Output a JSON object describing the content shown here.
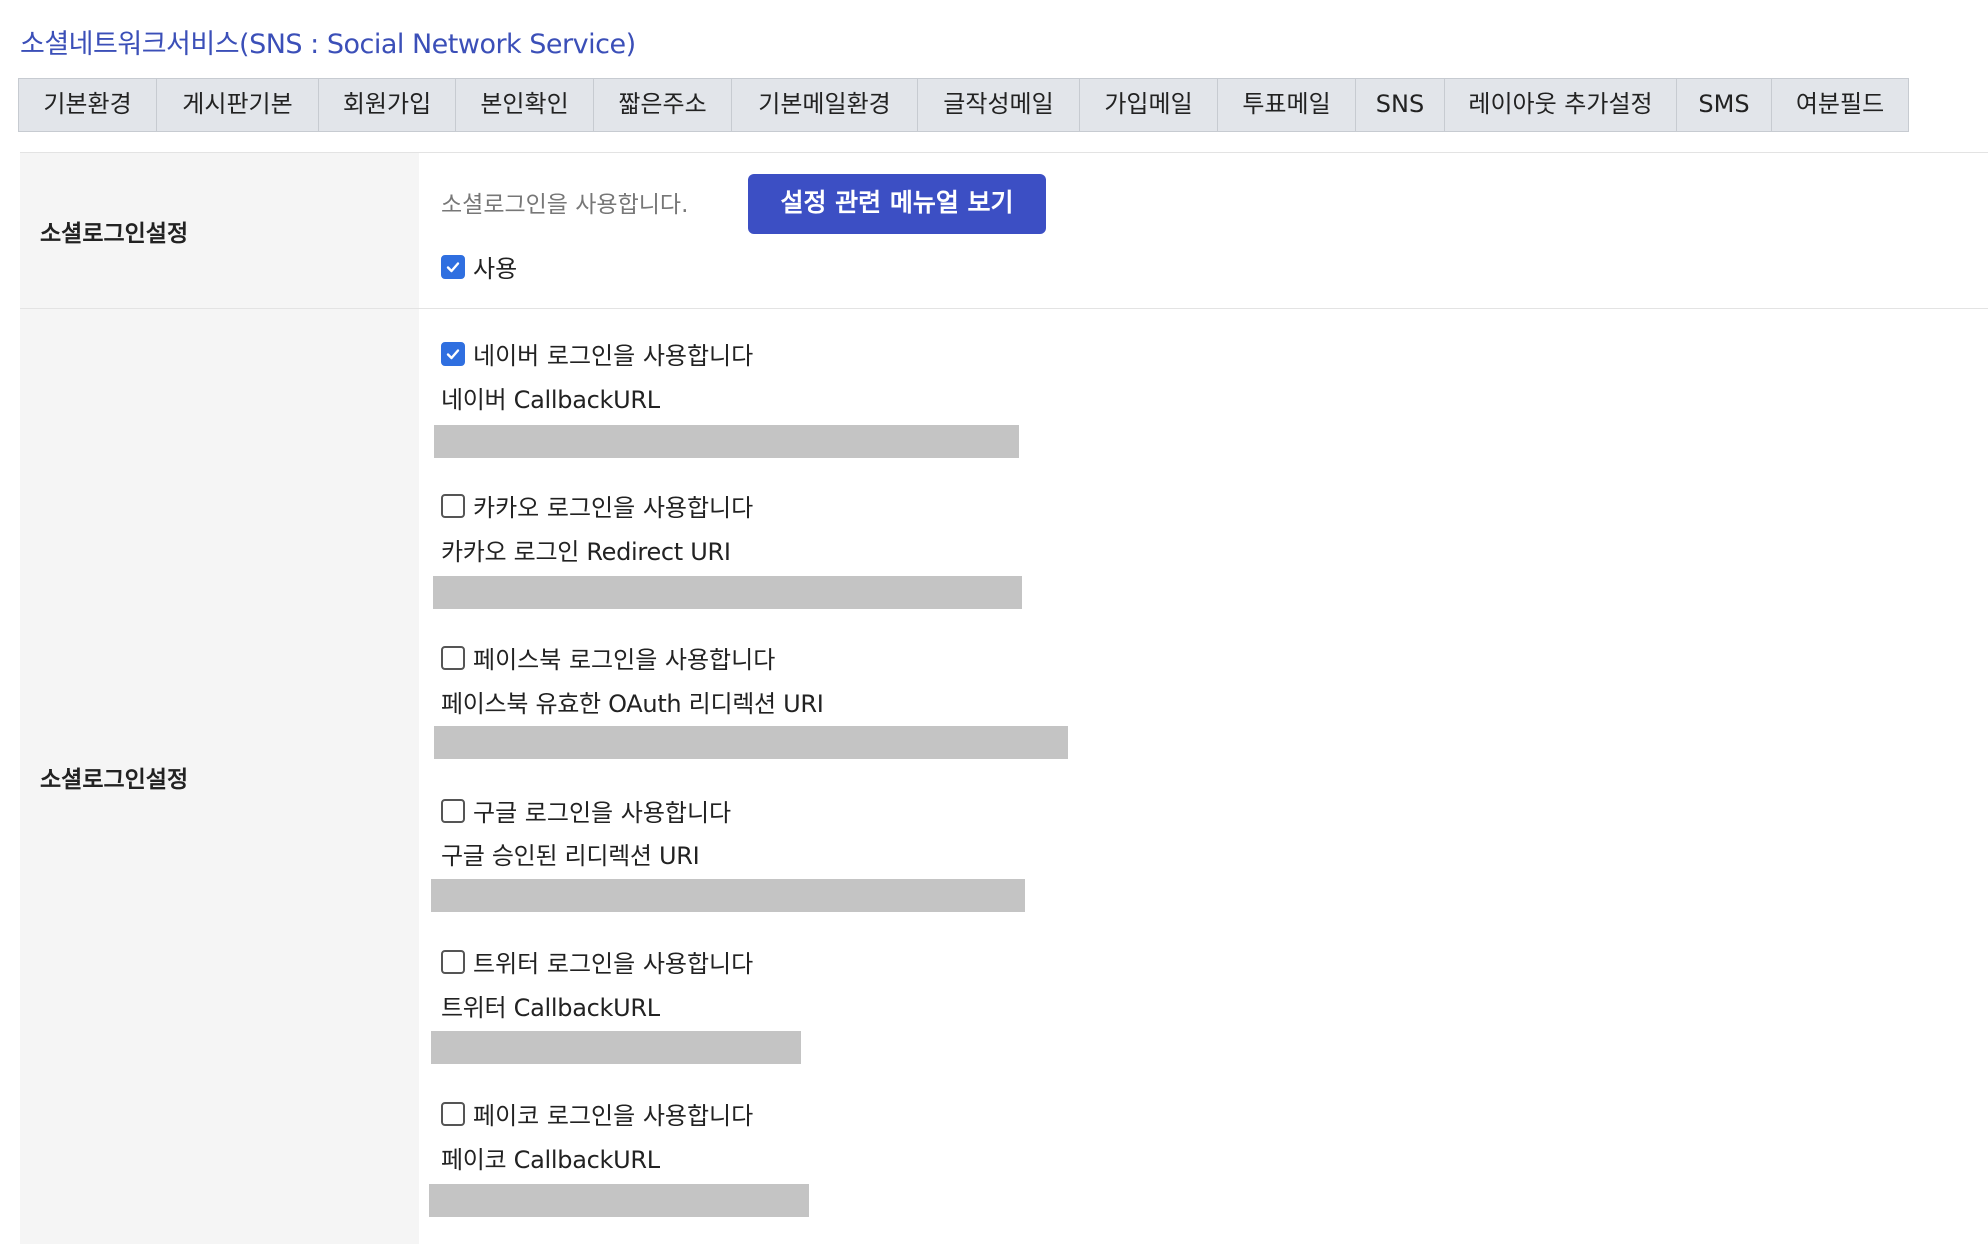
{
  "page": {
    "title": "소셜네트워크서비스(SNS : Social Network Service)"
  },
  "tabs": [
    {
      "label": "기본환경"
    },
    {
      "label": "게시판기본"
    },
    {
      "label": "회원가입"
    },
    {
      "label": "본인확인"
    },
    {
      "label": "짧은주소"
    },
    {
      "label": "기본메일환경"
    },
    {
      "label": "글작성메일"
    },
    {
      "label": "가입메일"
    },
    {
      "label": "투표메일"
    },
    {
      "label": "SNS"
    },
    {
      "label": "레이아웃 추가설정"
    },
    {
      "label": "SMS"
    },
    {
      "label": "여분필드"
    }
  ],
  "social_login_enable": {
    "label": "소셜로그인설정",
    "help_text": "소셜로그인을 사용합니다.",
    "manual_button_label": "설정 관련 메뉴얼 보기",
    "use_checkbox_label": "사용",
    "use_checked": true
  },
  "providers_section": {
    "label": "소셜로그인설정",
    "providers": [
      {
        "checkbox_label": "네이버 로그인을 사용합니다",
        "checked": true,
        "url_label": "네이버 CallbackURL"
      },
      {
        "checkbox_label": "카카오 로그인을 사용합니다",
        "checked": false,
        "url_label": "카카오 로그인 Redirect URI"
      },
      {
        "checkbox_label": "페이스북 로그인을 사용합니다",
        "checked": false,
        "url_label": "페이스북 유효한 OAuth 리디렉션 URI"
      },
      {
        "checkbox_label": "구글 로그인을 사용합니다",
        "checked": false,
        "url_label": "구글 승인된 리디렉션 URI"
      },
      {
        "checkbox_label": "트위터 로그인을 사용합니다",
        "checked": false,
        "url_label": "트위터 CallbackURL"
      },
      {
        "checkbox_label": "페이코 로그인을 사용합니다",
        "checked": false,
        "url_label": "페이코 CallbackURL"
      }
    ]
  },
  "colors": {
    "title": "#3b4fb8",
    "tab_background": "#e2e5ea",
    "button_primary": "#3c4fc4",
    "checkbox_checked": "#2f6fe0",
    "label_cell_background": "#f5f5f5",
    "redacted_field": "#c4c4c4"
  }
}
